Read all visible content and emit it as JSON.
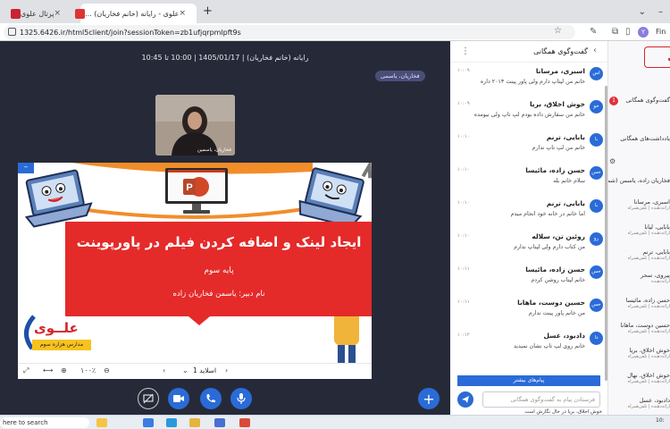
{
  "browser": {
    "tabs": [
      {
        "label": "پرتال علوی"
      },
      {
        "label": "علوی - رایانه (خانم فخاریان) ..."
      }
    ],
    "new_tab": "+",
    "address": "1325.6426.ir/html5client/join?sessionToken=zb1ufjqrpmlpft9s",
    "profile_initial": "Y",
    "profile_label": "Fin"
  },
  "meeting": {
    "title": "رایانه (خانم فخاریان) | 1405/01/17 | 10:00 تا 10:45",
    "speaker": "فخاریان، یاسمی",
    "webcam_name": "فخاریان، یاسمین"
  },
  "slide": {
    "heading": "ایجاد لینک و اضافه کردن فیلم در پاورپوینت",
    "grade": "پایه سوم",
    "teacher": "نام دبیر: یاسمن فخاریان زاده",
    "logo_name": "علــوی",
    "logo_sub": "مدارس هزاره سوم",
    "counter": "اسلاید 1",
    "zoom": "۱۰۰٪",
    "minimize": "–"
  },
  "chat": {
    "title": "گفت‌وگوی همگانی",
    "messages": [
      {
        "avatar": "اس",
        "name": "اسبری، مرسانا",
        "time": "۱۰:۰۹",
        "text": "خانم من لپتاپ دارم ولی پاور پینت ۲۰۱۳ داره"
      },
      {
        "avatar": "خو",
        "name": "خوش اخلاق، بریا",
        "time": "۱۰:۰۹",
        "text": "خانم من سفارش داده بودم لپ تاپ ولی نیومده"
      },
      {
        "avatar": "با",
        "name": "بابایی، ترنم",
        "time": "۱۰:۱۰",
        "text": "خانم من لپ تاپ ندارم"
      },
      {
        "avatar": "حس",
        "name": "حسن زاده، مائیسا",
        "time": "۱۰:۱۰",
        "text": "سلام خانم بله"
      },
      {
        "avatar": "با",
        "name": "بابایی، ترنم",
        "time": "۱۰:۱۰",
        "text": "اما خانم در خانه خود انجام میدم"
      },
      {
        "avatar": "رو",
        "name": "روئین تن، سلاله",
        "time": "۱۰:۱۰",
        "text": "من کتاب دارم ولی لپتاپ ندارم"
      },
      {
        "avatar": "حس",
        "name": "حسن زاده، مائیسا",
        "time": "۱۰:۱۱",
        "text": "خانم لپتاب روشن کردم"
      },
      {
        "avatar": "حس",
        "name": "حسین دوست، ماهانا",
        "time": "۱۰:۱۱",
        "text": "من خانم پاور پینت ندارم"
      },
      {
        "avatar": "دا",
        "name": "دادبود، عسل",
        "time": "۱۰:۱۲",
        "text": "خانم روی لپ تاپ نشان نمیدید"
      }
    ],
    "more_messages": "پیام‌های بیشتر",
    "input_placeholder": "فرستادن پیام به گفت‌وگوی همگانی",
    "typing": "خوش اخلاق، بریا در حال نگارش است"
  },
  "users": {
    "brand": "علـوی",
    "badge": "1",
    "rows": [
      {
        "label": "گفت‌وگوی همگانی",
        "sub": ""
      },
      {
        "label": "یادداشت‌های همگانی",
        "sub": ""
      },
      {
        "label": "فخاریان زاده، یاسمن (شما)",
        "sub": ""
      },
      {
        "label": "اسبری، مرسانا",
        "sub": "ارائه‌دهنده | تلفن‌همراه"
      },
      {
        "label": "بابایی، لیانا",
        "sub": "ارائه‌دهنده | تلفن‌همراه"
      },
      {
        "label": "بابایی، ترنم",
        "sub": "ارائه‌دهنده | تلفن‌همراه"
      },
      {
        "label": "پیروی، سحر",
        "sub": "ارائه‌دهنده"
      },
      {
        "label": "حسن زاده، مائیسا",
        "sub": "ارائه‌دهنده | تلفن‌همراه"
      },
      {
        "label": "حسین دوست، ماهانا",
        "sub": "ارائه‌دهنده | تلفن‌همراه"
      },
      {
        "label": "خوش اخلاق، بریا",
        "sub": "ارائه‌دهنده | تلفن‌همراه"
      },
      {
        "label": "خوش اخلاق، نهال",
        "sub": "ارائه‌دهنده | تلفن‌همراه"
      },
      {
        "label": "دادبود، عسل",
        "sub": "ارائه‌دهنده | تلفن‌همراه"
      }
    ]
  },
  "taskbar": {
    "search": "here to search",
    "clock": "10:"
  }
}
